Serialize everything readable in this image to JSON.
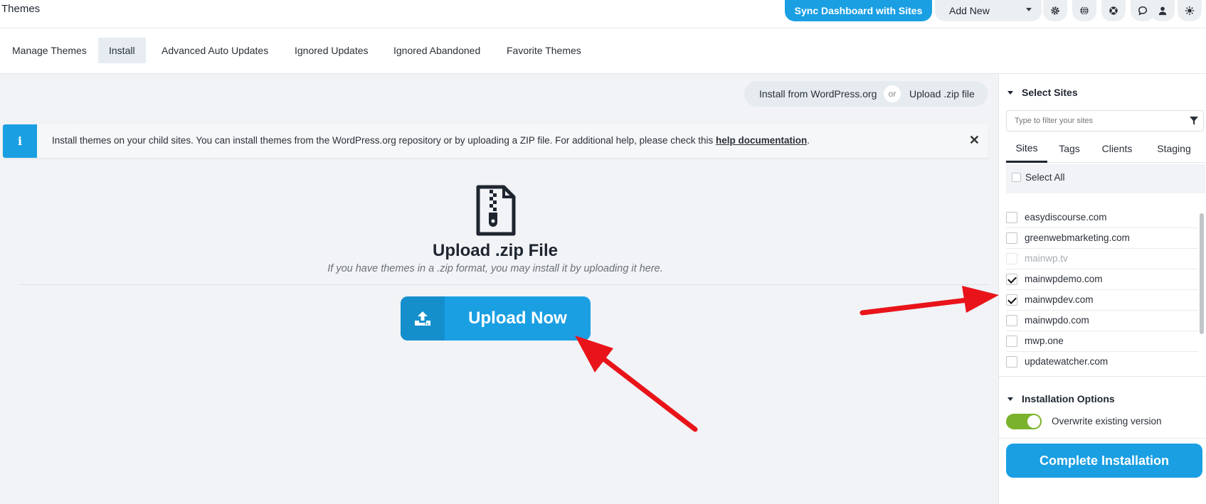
{
  "header": {
    "title": "Themes",
    "sync_label": "Sync Dashboard with Sites",
    "add_new_label": "Add New",
    "icons": [
      "gear-icon",
      "globe-icon",
      "life-ring-icon",
      "chat-icon",
      "user-icon",
      "sun-icon"
    ]
  },
  "tabs": [
    {
      "label": "Manage Themes"
    },
    {
      "label": "Install",
      "active": true
    },
    {
      "label": "Advanced Auto Updates"
    },
    {
      "label": "Ignored Updates"
    },
    {
      "label": "Ignored Abandoned"
    },
    {
      "label": "Favorite Themes"
    }
  ],
  "source_switch": {
    "wp_label": "Install from WordPress.org",
    "or_label": "or",
    "zip_label": "Upload .zip file"
  },
  "notice": {
    "text": "Install themes on your child sites. You can install themes from the WordPress.org repository or by uploading a ZIP file. For additional help, please check this ",
    "link": "help documentation",
    "suffix": "."
  },
  "upload": {
    "title": "Upload .zip File",
    "subtitle": "If you have themes in a .zip format, you may install it by uploading it here.",
    "button_label": "Upload Now"
  },
  "sidebar": {
    "select_sites_label": "Select Sites",
    "filter_placeholder": "Type to filter your sites",
    "tabs": [
      "Sites",
      "Tags",
      "Clients",
      "Staging"
    ],
    "select_all_label": "Select All",
    "sites": [
      {
        "name": "easydiscourse.com",
        "checked": false
      },
      {
        "name": "greenwebmarketing.com",
        "checked": false
      },
      {
        "name": "mainwp.tv",
        "checked": false,
        "disabled": true
      },
      {
        "name": "mainwpdemo.com",
        "checked": true
      },
      {
        "name": "mainwpdev.com",
        "checked": true
      },
      {
        "name": "mainwpdo.com",
        "checked": false
      },
      {
        "name": "mwp.one",
        "checked": false
      },
      {
        "name": "updatewatcher.com",
        "checked": false
      }
    ],
    "installation_options_label": "Installation Options",
    "overwrite_label": "Overwrite existing version",
    "overwrite_enabled": true,
    "complete_label": "Complete Installation"
  },
  "colors": {
    "primary": "#1a9fe3",
    "toggle_on": "#7bb22b",
    "annotation_arrow": "#e8141a"
  }
}
